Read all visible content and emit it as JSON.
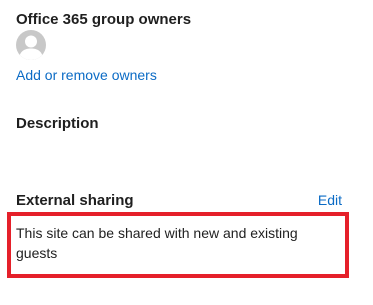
{
  "group_owners": {
    "title": "Office 365 group owners",
    "add_remove_label": "Add or remove owners"
  },
  "description": {
    "title": "Description"
  },
  "external_sharing": {
    "title": "External sharing",
    "edit_label": "Edit",
    "status_text": "This site can be shared with new and existing guests"
  },
  "colors": {
    "link": "#0b6bc5",
    "highlight": "#e5202a",
    "avatar": "#c8c8c8"
  },
  "icons": {
    "avatar": "person-icon"
  }
}
